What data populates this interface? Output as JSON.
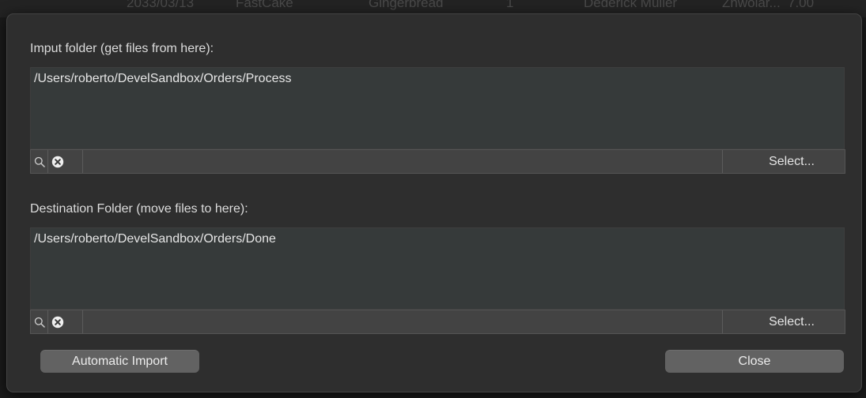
{
  "background_table": {
    "row": [
      "2033/03/13",
      "FastCake",
      "Gingerbread",
      "1",
      "Dederick Muller",
      "Zhwolar...",
      "7.00"
    ]
  },
  "input_section": {
    "label": "Imput folder (get files from here):",
    "path": "/Users/roberto/DevelSandbox/Orders/Process",
    "search_icon": "magnifier-icon",
    "clear_icon": "clear-circle-x-icon",
    "select_label": "Select..."
  },
  "destination_section": {
    "label": "Destination Folder (move files to here):",
    "path": "/Users/roberto/DevelSandbox/Orders/Done",
    "search_icon": "magnifier-icon",
    "clear_icon": "clear-circle-x-icon",
    "select_label": "Select..."
  },
  "footer": {
    "auto_import_label": "Automatic Import",
    "close_label": "Close"
  },
  "colors": {
    "dialog_bg": "#2e2e2e",
    "field_bg": "#363a3a",
    "button_bg": "#626262",
    "text": "#e6e6e6"
  }
}
